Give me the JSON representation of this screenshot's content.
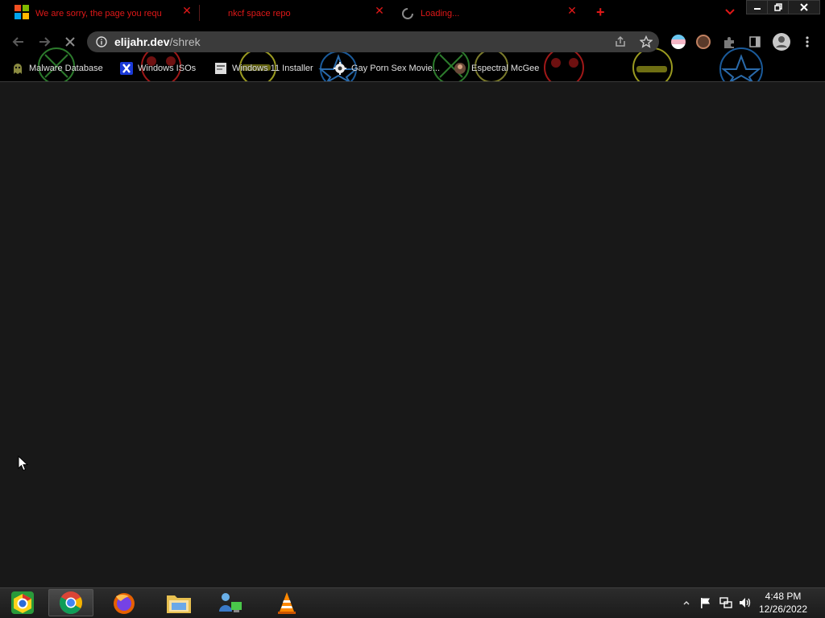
{
  "browser": {
    "tabs": [
      {
        "title": "We are sorry, the page you requ",
        "close": "✕"
      },
      {
        "title": "nkcf space repo",
        "close": "✕"
      },
      {
        "title": "Loading...",
        "close": "✕"
      }
    ],
    "new_tab": "+",
    "omnibox": {
      "host": "elijahr.dev",
      "path": "/shrek"
    },
    "window_controls": {
      "minimize": "—",
      "restore": "❐",
      "close": "✕"
    }
  },
  "bookmarks": [
    {
      "label": "Malware Database",
      "icon": "ghost-icon"
    },
    {
      "label": "Windows ISOs",
      "icon": "x-logo-icon"
    },
    {
      "label": "Windows 11 Installer",
      "icon": "page-icon"
    },
    {
      "label": "Gay Porn Sex Movie...",
      "icon": "gear-logo-icon"
    },
    {
      "label": "Espectral McGee",
      "icon": "avatar-icon"
    }
  ],
  "taskbar": {
    "clock_time": "4:48 PM",
    "clock_date": "12/26/2022"
  },
  "colors": {
    "tab_text": "#e01818",
    "chrome_bg": "#000000",
    "omnibox_bg": "#3b3b3b",
    "content_bg": "#181818"
  }
}
